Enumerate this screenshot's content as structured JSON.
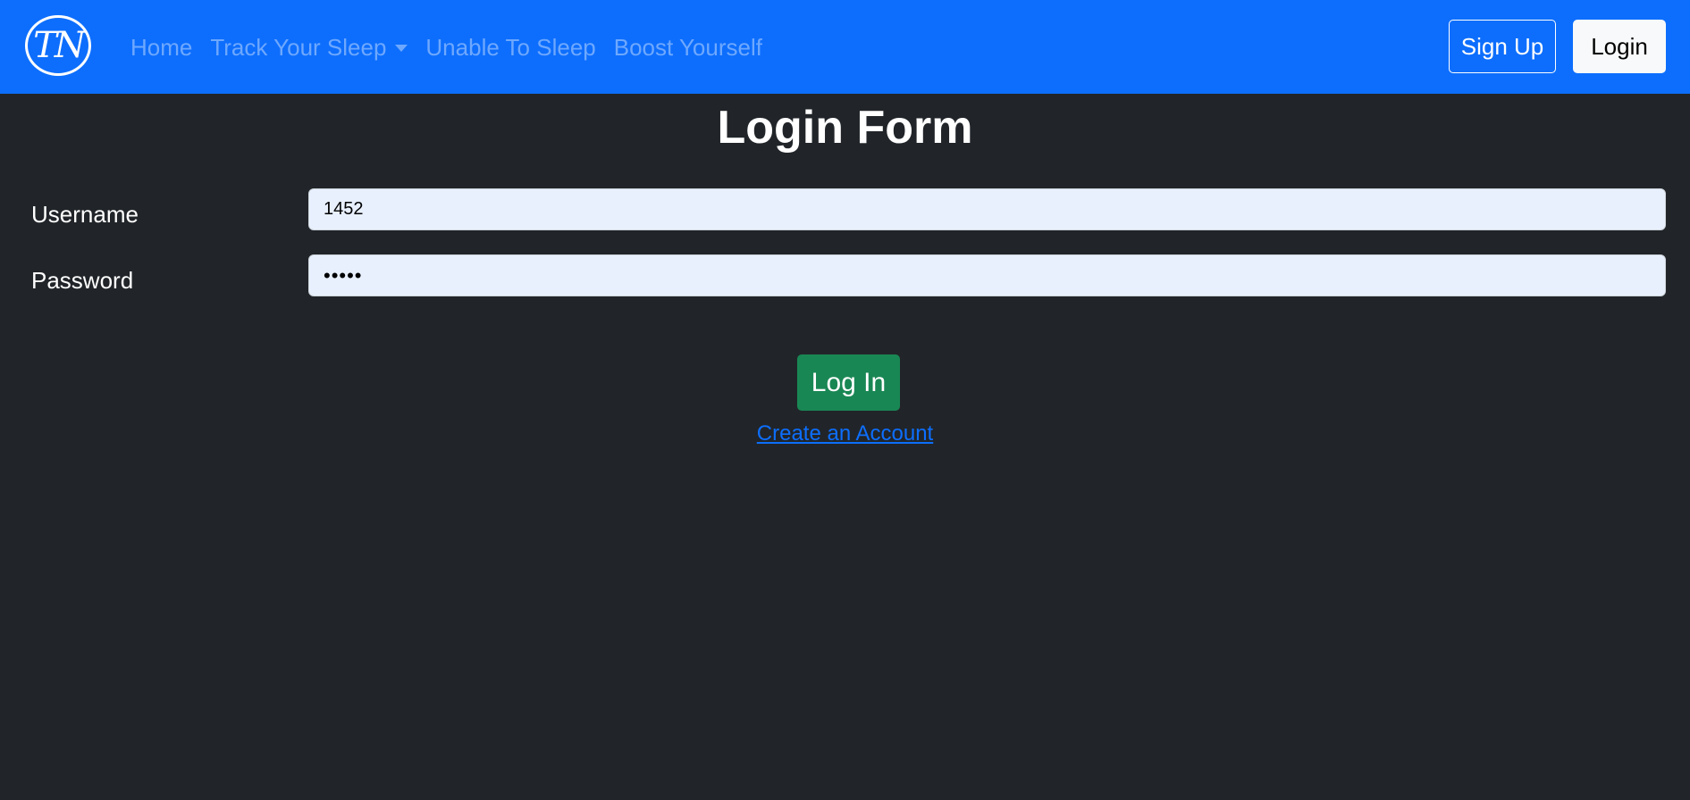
{
  "navbar": {
    "logo_text": "TN",
    "links": {
      "home": "Home",
      "track_sleep": "Track Your Sleep",
      "unable_to_sleep": "Unable To Sleep",
      "boost_yourself": "Boost Yourself"
    },
    "signup_label": "Sign Up",
    "login_label": "Login"
  },
  "form": {
    "title": "Login Form",
    "username_label": "Username",
    "username_value": "1452",
    "password_label": "Password",
    "password_value": "•••••",
    "submit_label": "Log In",
    "create_account_label": "Create an Account"
  },
  "colors": {
    "navbar_bg": "#0d6efd",
    "page_bg": "#212529",
    "nav_link": "#6ea8fe",
    "submit_bg": "#198754",
    "input_bg": "#e8f0fe",
    "link": "#0d6efd"
  }
}
